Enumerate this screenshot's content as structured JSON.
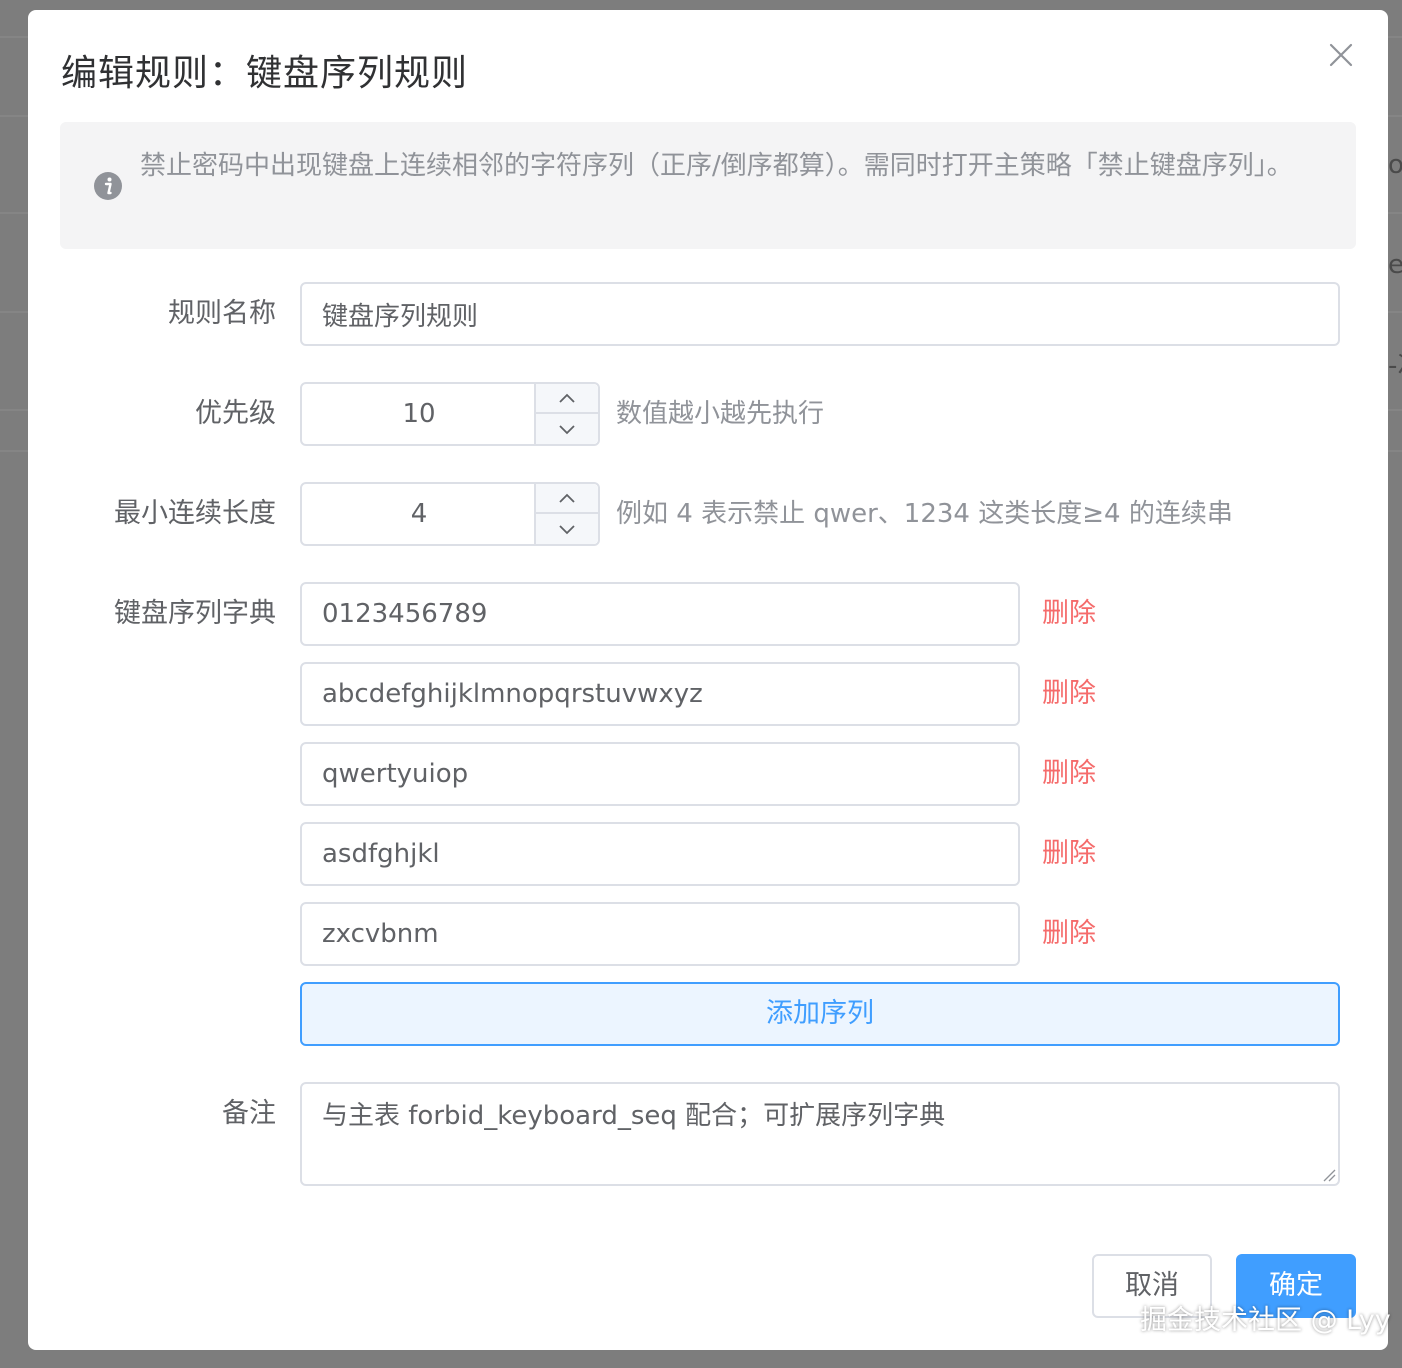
{
  "dialog": {
    "title": "编辑规则：键盘序列规则",
    "alert_text": "禁止密码中出现键盘上连续相邻的字符序列（正序/倒序都算）。需同时打开主策略「禁止键盘序列」。"
  },
  "form": {
    "name": {
      "label": "规则名称",
      "value": "键盘序列规则"
    },
    "priority": {
      "label": "优先级",
      "value": "10",
      "hint": "数值越小越先执行"
    },
    "min_length": {
      "label": "最小连续长度",
      "value": "4",
      "hint": "例如 4 表示禁止 qwer、1234 这类长度≥4 的连续串"
    },
    "dictionary": {
      "label": "键盘序列字典",
      "sequences": [
        "0123456789",
        "abcdefghijklmnopqrstuvwxyz",
        "qwertyuiop",
        "asdfghjkl",
        "zxcvbnm"
      ],
      "delete_label": "删除",
      "add_label": "添加序列"
    },
    "remark": {
      "label": "备注",
      "value": "与主表 forbid_keyboard_seq 配合；可扩展序列字典"
    }
  },
  "footer": {
    "cancel_label": "取消",
    "confirm_label": "确定"
  },
  "background_fragments": [
    "or",
    "e",
    "-次"
  ],
  "watermark": "掘金技术社区 @ Lyy",
  "colors": {
    "primary": "#409eff",
    "danger": "#f56c6c",
    "alert_bg": "#f4f4f5",
    "mask": "#808080"
  }
}
